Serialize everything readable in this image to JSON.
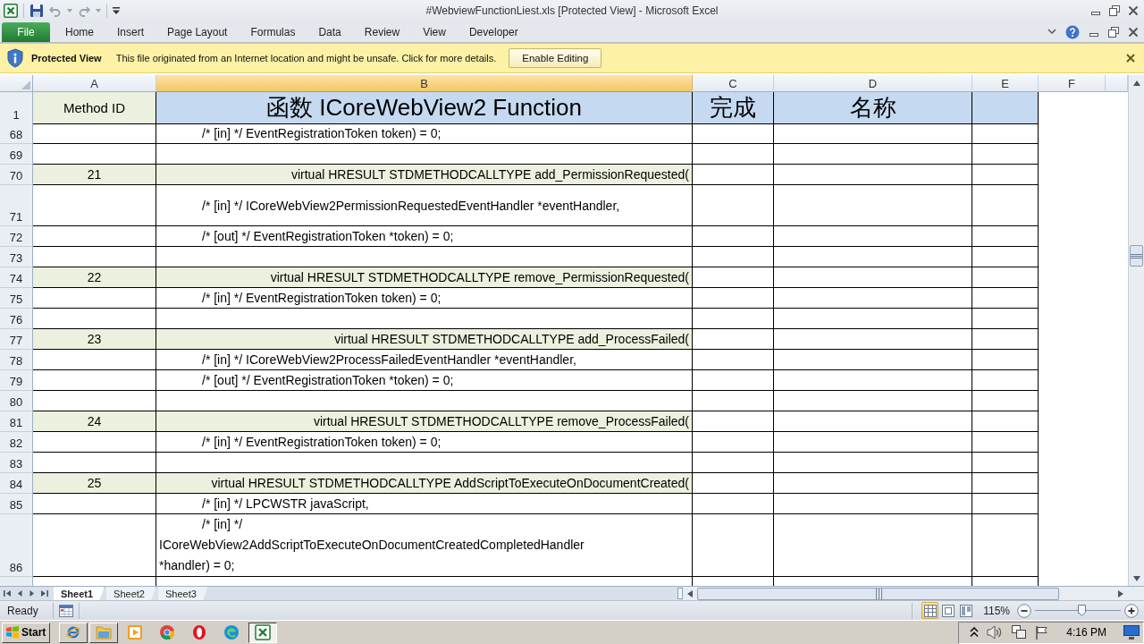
{
  "window": {
    "title": "#WebviewFunctionLiest.xls [Protected View] - Microsoft Excel"
  },
  "ribbon_tabs": [
    {
      "label": "File",
      "kind": "backstage",
      "selected": false
    },
    {
      "label": "Home",
      "kind": "tab",
      "selected": false
    },
    {
      "label": "Insert",
      "kind": "tab",
      "selected": false
    },
    {
      "label": "Page Layout",
      "kind": "tab",
      "selected": false
    },
    {
      "label": "Formulas",
      "kind": "tab",
      "selected": false
    },
    {
      "label": "Data",
      "kind": "tab",
      "selected": false
    },
    {
      "label": "Review",
      "kind": "tab",
      "selected": false
    },
    {
      "label": "View",
      "kind": "tab",
      "selected": false
    },
    {
      "label": "Developer",
      "kind": "tab",
      "selected": false
    }
  ],
  "protected_view": {
    "title": "Protected View",
    "message": "This file originated from an Internet location and might be unsafe. Click for more details.",
    "button": "Enable Editing"
  },
  "sheet": {
    "columns": [
      {
        "label": "A",
        "selected": false
      },
      {
        "label": "B",
        "selected": true
      },
      {
        "label": "C",
        "selected": false
      },
      {
        "label": "D",
        "selected": false
      },
      {
        "label": "E",
        "selected": false
      },
      {
        "label": "F",
        "selected": false
      }
    ],
    "header_row": {
      "number": "1",
      "cells": [
        {
          "text": "Method ID",
          "color": "#ebf1de"
        },
        {
          "text": "函数 ICoreWebView2 Function",
          "color": "#c5d9f1"
        },
        {
          "text": "完成",
          "color": "#c5d9f1"
        },
        {
          "text": "名称",
          "color": "#c5d9f1"
        },
        {
          "color": "#c5d9f1"
        }
      ]
    },
    "rows": [
      {
        "number": "68",
        "kind": "parameter",
        "code": "/* [in] */ EventRegistrationToken token) = 0;"
      },
      {
        "number": "69",
        "kind": "blank"
      },
      {
        "number": "70",
        "kind": "declaration",
        "method_id": "21",
        "code": "virtual HRESULT STDMETHODCALLTYPE add_PermissionRequested("
      },
      {
        "number": "71",
        "kind": "parameter",
        "code": "/* [in] */ ICoreWebView2PermissionRequestedEventHandler *eventHandler,"
      },
      {
        "number": "72",
        "kind": "parameter",
        "code": "/* [out] */ EventRegistrationToken *token) = 0;"
      },
      {
        "number": "73",
        "kind": "blank"
      },
      {
        "number": "74",
        "kind": "declaration",
        "method_id": "22",
        "code": "virtual HRESULT STDMETHODCALLTYPE remove_PermissionRequested("
      },
      {
        "number": "75",
        "kind": "parameter",
        "code": "/* [in] */ EventRegistrationToken token) = 0;"
      },
      {
        "number": "76",
        "kind": "blank"
      },
      {
        "number": "77",
        "kind": "declaration",
        "method_id": "23",
        "code": "virtual HRESULT STDMETHODCALLTYPE add_ProcessFailed("
      },
      {
        "number": "78",
        "kind": "parameter",
        "code": "/* [in] */ ICoreWebView2ProcessFailedEventHandler *eventHandler,"
      },
      {
        "number": "79",
        "kind": "parameter",
        "code": "/* [out] */ EventRegistrationToken *token) = 0;"
      },
      {
        "number": "80",
        "kind": "blank"
      },
      {
        "number": "81",
        "kind": "declaration",
        "method_id": "24",
        "code": "virtual HRESULT STDMETHODCALLTYPE remove_ProcessFailed("
      },
      {
        "number": "82",
        "kind": "parameter",
        "code": "/* [in] */ EventRegistrationToken token) = 0;"
      },
      {
        "number": "83",
        "kind": "blank"
      },
      {
        "number": "84",
        "kind": "declaration",
        "method_id": "25",
        "code": "virtual HRESULT STDMETHODCALLTYPE AddScriptToExecuteOnDocumentCreated("
      },
      {
        "number": "85",
        "kind": "parameter",
        "code": "/* [in] */ LPCWSTR javaScript,"
      },
      {
        "number": "86",
        "kind": "wrapped",
        "lines": [
          "/* [in] */",
          "ICoreWebView2AddScriptToExecuteOnDocumentCreatedCompletedHandler",
          "*handler) = 0;"
        ]
      }
    ]
  },
  "sheet_tabs": [
    {
      "label": "Sheet1",
      "selected": true
    },
    {
      "label": "Sheet2",
      "selected": false
    },
    {
      "label": "Sheet3",
      "selected": false
    }
  ],
  "status_bar": {
    "status": "Ready",
    "views": [
      {
        "selected": true
      },
      {
        "selected": false
      },
      {
        "selected": false
      }
    ],
    "zoom": "115%",
    "zoom_slider": {
      "level": 0.55
    }
  },
  "taskbar": {
    "start": "Start",
    "apps": [
      {
        "kind": "window",
        "selected": false
      },
      {
        "kind": "window",
        "selected": false
      },
      {
        "kind": "launcher",
        "selected": false
      },
      {
        "kind": "launcher",
        "selected": false
      },
      {
        "kind": "launcher",
        "selected": false
      },
      {
        "kind": "launcher",
        "selected": false
      },
      {
        "kind": "window",
        "selected": true
      }
    ],
    "clock": "4:16 PM"
  }
}
